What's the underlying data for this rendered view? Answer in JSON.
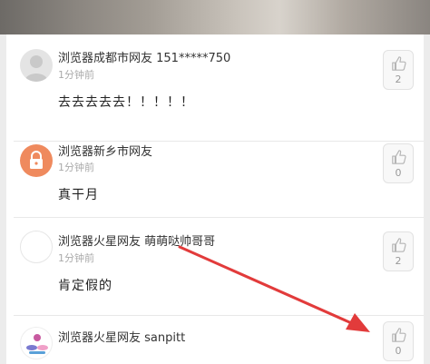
{
  "comments": [
    {
      "username": "浏览器成都市网友 151*****750",
      "time": "1分钟前",
      "text": "去去去去去！！！！！",
      "likes": "2",
      "avatar_icon": "default-user-avatar"
    },
    {
      "username": "浏览器新乡市网友",
      "time": "1分钟前",
      "text": "真干月",
      "likes": "0",
      "avatar_icon": "lock-avatar"
    },
    {
      "username": "浏览器火星网友 萌萌哒帅哥哥",
      "time": "1分钟前",
      "text": "肯定假的",
      "likes": "2",
      "avatar_icon": "blank-avatar"
    },
    {
      "username": "浏览器火星网友 sanpitt",
      "time": "",
      "text": "",
      "likes": "0",
      "avatar_icon": "logo-avatar"
    }
  ],
  "colors": {
    "lock_avatar": "#ef8a5e",
    "annotation_arrow": "#e23b3b"
  }
}
